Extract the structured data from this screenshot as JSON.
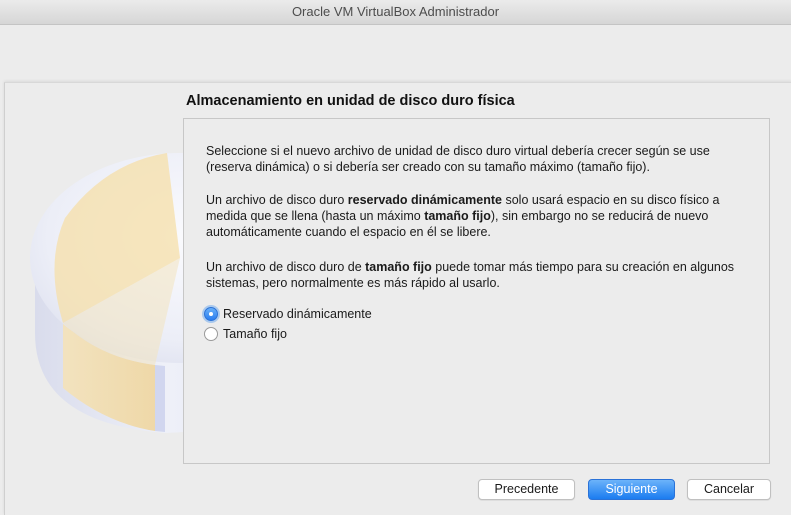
{
  "window": {
    "title": "Oracle VM VirtualBox Administrador"
  },
  "wizard": {
    "heading": "Almacenamiento en unidad de disco duro física",
    "paragraph1": "Seleccione si el nuevo archivo de unidad de disco duro virtual debería crecer según se use (reserva dinámica) o si debería ser creado con su tamaño máximo (tamaño fijo).",
    "paragraph2": {
      "part1": "Un archivo de disco duro ",
      "bold1": "reservado dinámicamente",
      "part2": " solo usará espacio en su disco físico a medida que se llena (hasta un máximo ",
      "bold2": "tamaño fijo",
      "part3": "), sin embargo no se reducirá de nuevo automáticamente cuando el espacio en él se libere."
    },
    "paragraph3": {
      "part1": "Un archivo de disco duro de ",
      "bold1": "tamaño fijo",
      "part2": " puede tomar más tiempo para su creación en algunos sistemas, pero normalmente es más rápido al usarlo."
    },
    "options": [
      {
        "label": "Reservado dinámicamente",
        "selected": true
      },
      {
        "label": "Tamaño fijo",
        "selected": false
      }
    ],
    "buttons": {
      "back": "Precedente",
      "next": "Siguiente",
      "cancel": "Cancelar"
    }
  },
  "colors": {
    "accent": "#2a7ef0",
    "background": "#ececec",
    "pie_slice": "#f5dfa8"
  }
}
